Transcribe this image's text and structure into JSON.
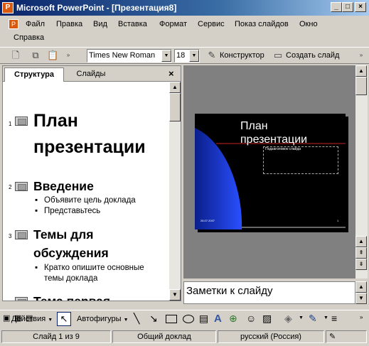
{
  "window": {
    "title": "Microsoft PowerPoint - [Презентация8]",
    "app_icon": "P"
  },
  "menu": {
    "items": [
      "Файл",
      "Правка",
      "Вид",
      "Вставка",
      "Формат",
      "Сервис",
      "Показ слайдов",
      "Окно",
      "Справка"
    ]
  },
  "toolbar": {
    "font_name": "Times New Roman",
    "font_size": "18",
    "designer_label": "Конструктор",
    "new_slide_label": "Создать слайд"
  },
  "left_pane": {
    "tabs": [
      "Структура",
      "Слайды"
    ],
    "outline": [
      {
        "num": "1",
        "title_lines": [
          "План",
          "презентации"
        ],
        "bullets": []
      },
      {
        "num": "2",
        "title_lines": [
          "Введение"
        ],
        "bullets": [
          [
            "Объявите цель доклада"
          ],
          [
            "Представьтесь"
          ]
        ]
      },
      {
        "num": "3",
        "title_lines": [
          "Темы для",
          "обсуждения"
        ],
        "bullets": [
          [
            "Кратко опишите основные",
            "темы доклада"
          ]
        ]
      },
      {
        "num": "4",
        "title_lines": [
          "Тема первая"
        ],
        "bullets": []
      }
    ]
  },
  "slide": {
    "title_lines": [
      "План",
      "презентации"
    ],
    "subtitle_placeholder": "Подзаголовок слайда",
    "footer_left": "28.07.2007",
    "footer_right": "1",
    "colors": {
      "background": "#000000",
      "accent_line": "#cc2222",
      "gradient": "#1f3fd0"
    }
  },
  "notes": {
    "placeholder": "Заметки к слайду"
  },
  "drawbar": {
    "actions_label": "Действия",
    "autoshapes_label": "Автофигуры"
  },
  "status": {
    "slide": "Слайд 1 из 9",
    "design": "Общий доклад",
    "language": "русский (Россия)"
  }
}
